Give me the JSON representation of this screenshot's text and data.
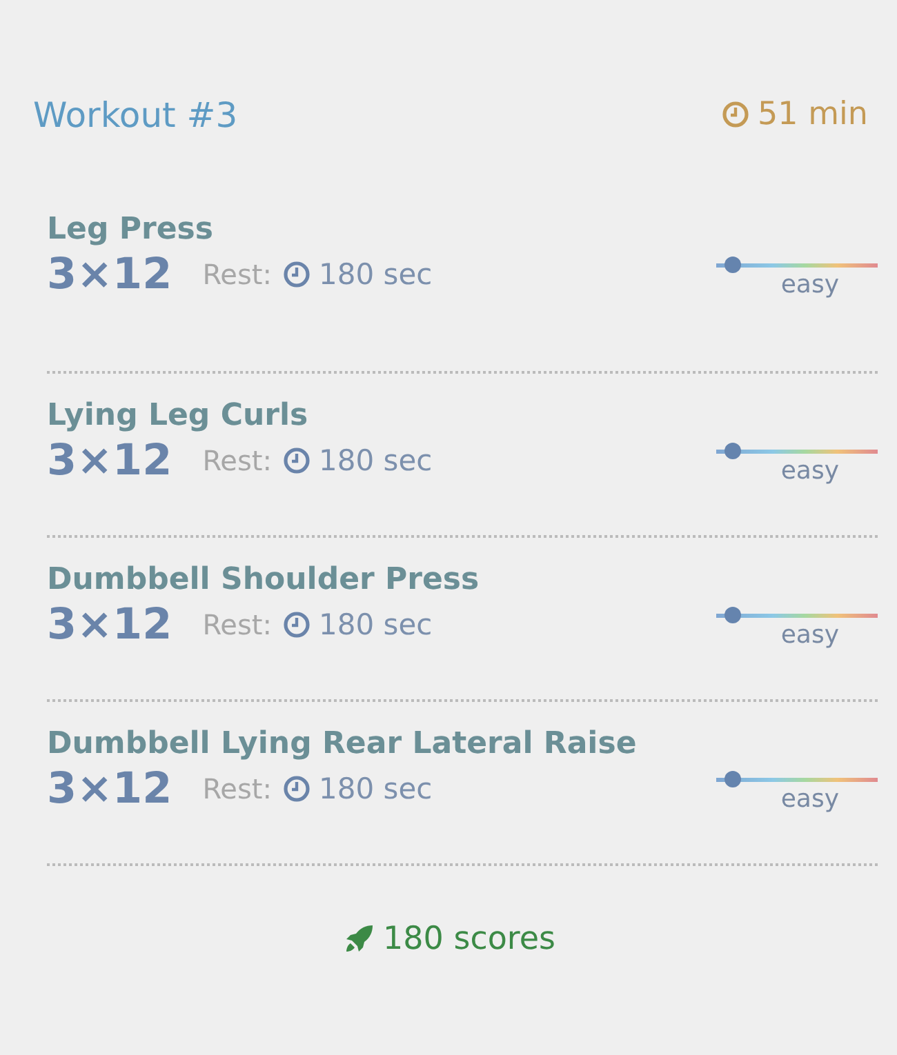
{
  "header": {
    "title": "Workout #3",
    "duration": "51 min"
  },
  "exercises": [
    {
      "name": "Leg Press",
      "sets": "3×12",
      "rest_label": "Rest:",
      "rest": "180 sec",
      "difficulty": {
        "level": 0.1,
        "label": "easy"
      }
    },
    {
      "name": "Lying Leg Curls",
      "sets": "3×12",
      "rest_label": "Rest:",
      "rest": "180 sec",
      "difficulty": {
        "level": 0.1,
        "label": "easy"
      }
    },
    {
      "name": "Dumbbell Shoulder Press",
      "sets": "3×12",
      "rest_label": "Rest:",
      "rest": "180 sec",
      "difficulty": {
        "level": 0.1,
        "label": "easy"
      }
    },
    {
      "name": "Dumbbell Lying Rear Lateral Raise",
      "sets": "3×12",
      "rest_label": "Rest:",
      "rest": "180 sec",
      "difficulty": {
        "level": 0.1,
        "label": "easy"
      }
    }
  ],
  "footer": {
    "score": "180 scores"
  }
}
